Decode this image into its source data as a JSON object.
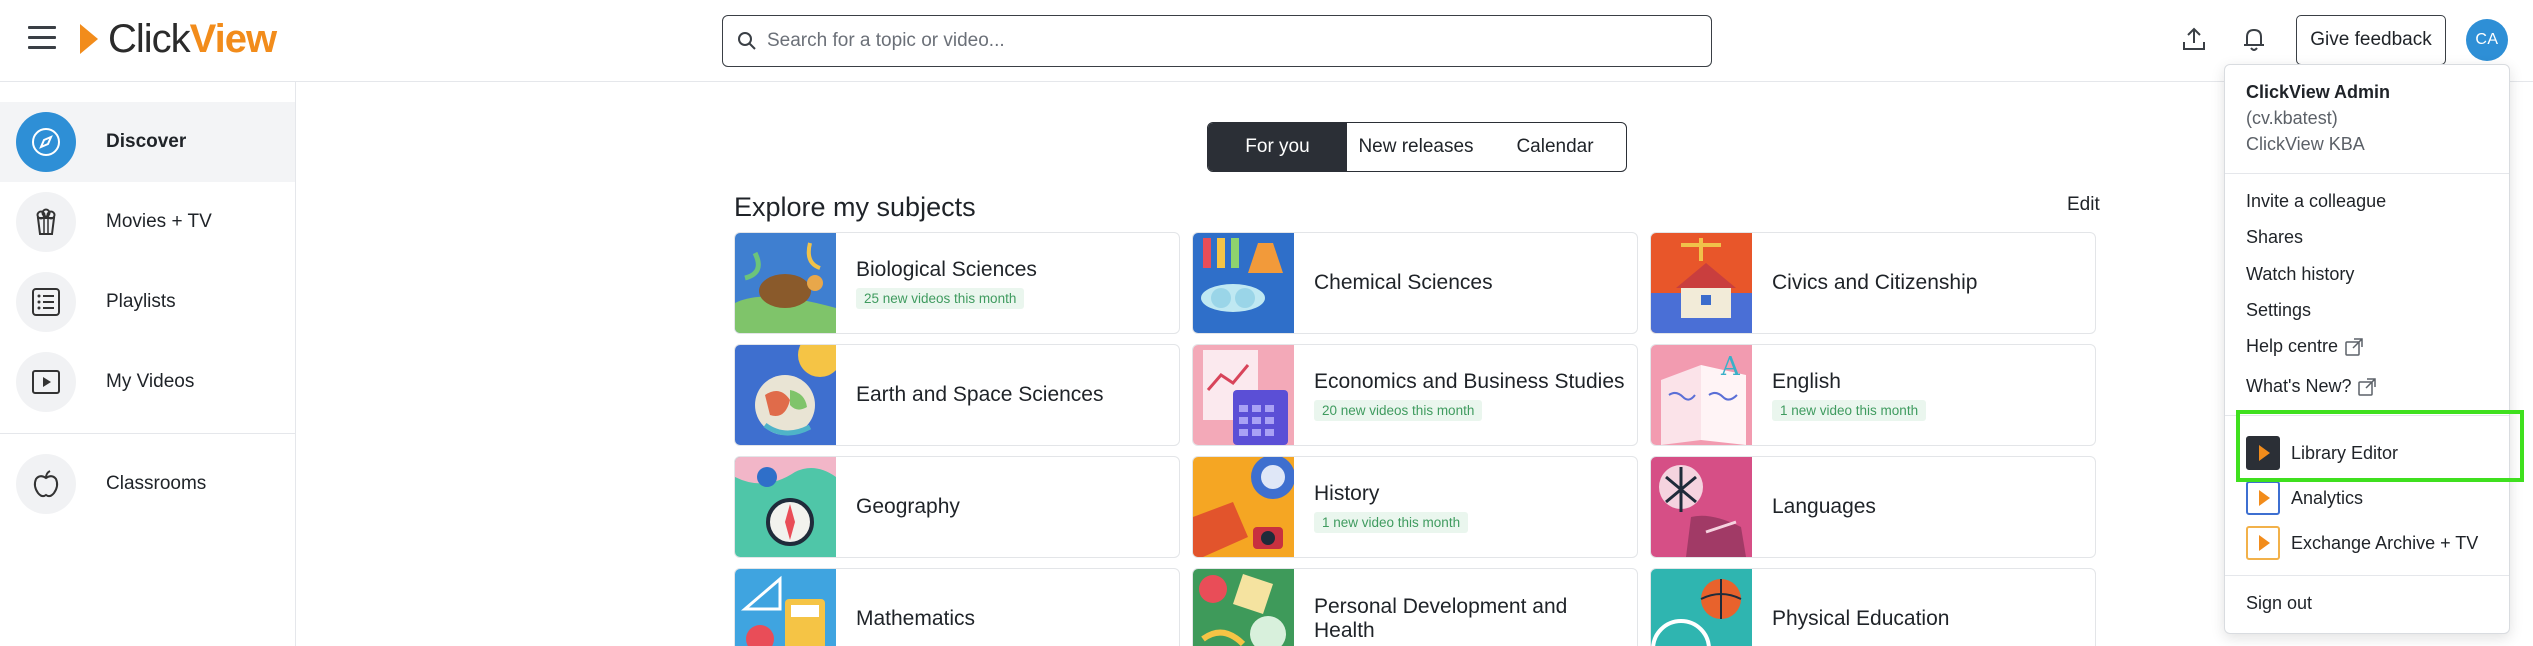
{
  "header": {
    "logo_prefix": "Click",
    "logo_suffix": "View",
    "search_placeholder": "Search for a topic or video...",
    "feedback_label": "Give feedback",
    "avatar_initials": "CA"
  },
  "sidebar": {
    "items": [
      {
        "label": "Discover",
        "icon": "compass-icon",
        "active": true
      },
      {
        "label": "Movies + TV",
        "icon": "popcorn-icon"
      },
      {
        "label": "Playlists",
        "icon": "list-icon"
      },
      {
        "label": "My Videos",
        "icon": "play-box-icon"
      },
      {
        "label": "Classrooms",
        "icon": "apple-icon"
      }
    ]
  },
  "tabs": [
    "For you",
    "New releases",
    "Calendar"
  ],
  "subjects_section": {
    "title": "Explore my subjects",
    "edit_label": "Edit",
    "subjects": [
      {
        "name": "Biological Sciences",
        "badge": "25 new videos this month"
      },
      {
        "name": "Chemical Sciences",
        "badge": ""
      },
      {
        "name": "Civics and Citizenship",
        "badge": ""
      },
      {
        "name": "Earth and Space Sciences",
        "badge": ""
      },
      {
        "name": "Economics and Business Studies",
        "badge": "20 new videos this month"
      },
      {
        "name": "English",
        "badge": "1 new video this month"
      },
      {
        "name": "Geography",
        "badge": ""
      },
      {
        "name": "History",
        "badge": "1 new video this month"
      },
      {
        "name": "Languages",
        "badge": ""
      },
      {
        "name": "Mathematics",
        "badge": ""
      },
      {
        "name": "Personal Development and Health",
        "badge": ""
      },
      {
        "name": "Physical Education",
        "badge": ""
      }
    ]
  },
  "user_menu": {
    "name": "ClickView Admin",
    "username": "(cv.kbatest)",
    "org": "ClickView KBA",
    "links": [
      "Invite a colleague",
      "Shares",
      "Watch history",
      "Settings",
      "Help centre",
      "What's New?"
    ],
    "apps": [
      {
        "label": "Library Editor",
        "bg": "#2b2f36",
        "border": "#2b2f36"
      },
      {
        "label": "Analytics",
        "bg": "#ffffff",
        "border": "#3d6fd1"
      },
      {
        "label": "Exchange Archive + TV",
        "bg": "#ffffff",
        "border": "#f2b14a"
      }
    ],
    "sign_out": "Sign out"
  },
  "colors": {
    "accent": "#2e8fd6",
    "brand_orange": "#f28c1b",
    "highlight": "#3fe01e"
  }
}
